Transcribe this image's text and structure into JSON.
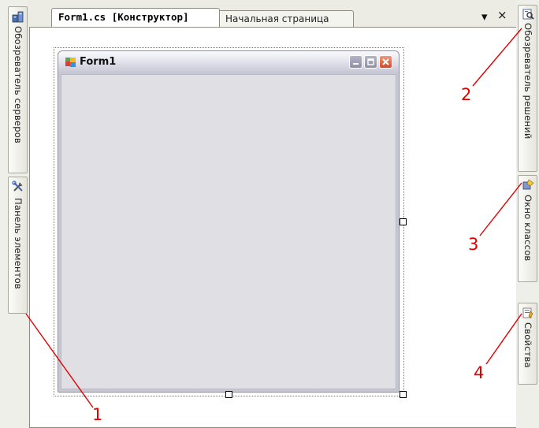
{
  "left_dock": {
    "server_explorer_label": "Обозреватель серверов",
    "toolbox_label": "Панель элементов"
  },
  "document_tabs": [
    {
      "label": "Form1.cs [Конструктор]",
      "active": true
    },
    {
      "label": "Начальная страница",
      "active": false
    }
  ],
  "tab_controls": {
    "dropdown": "▾",
    "close": "×"
  },
  "designer": {
    "form_title": "Form1"
  },
  "right_dock": {
    "solution_explorer_label": "Обозреватель решений",
    "class_view_label": "Окно классов",
    "properties_label": "Свойства"
  },
  "annotations": [
    "1",
    "2",
    "3",
    "4"
  ],
  "colors": {
    "annotation": "#e00000",
    "designer_client": "#e0dfe3"
  }
}
